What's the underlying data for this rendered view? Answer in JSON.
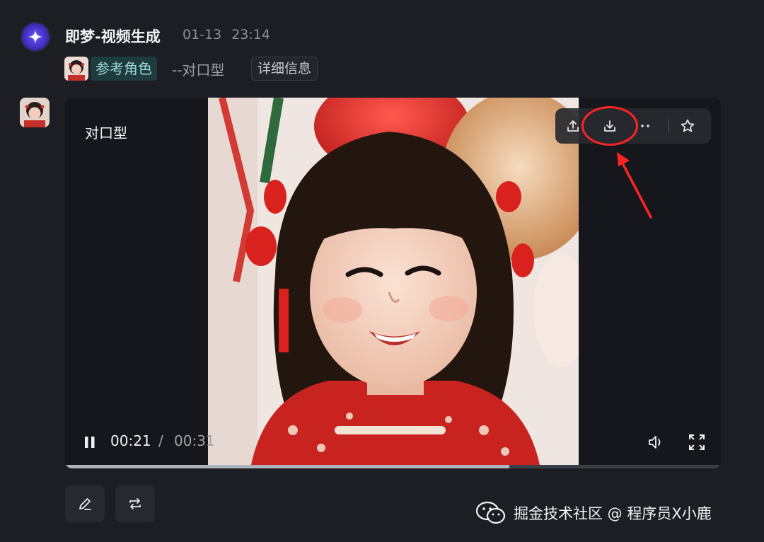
{
  "header": {
    "app_title": "即梦-视频生成",
    "date": "01-13",
    "time": "23:14"
  },
  "reference": {
    "chip_label": "参考角色",
    "mode": "--对口型",
    "detail_button": "详细信息"
  },
  "video": {
    "overlay_label": "对口型",
    "current_time": "00:21",
    "separator": "/",
    "total_time": "00:31",
    "progress": 0.677
  },
  "toolbar": {
    "icons": [
      "share-icon",
      "download-icon",
      "more-icon",
      "star-icon"
    ]
  },
  "actions": {
    "icons": [
      "edit-icon",
      "regenerate-icon"
    ]
  },
  "watermark": {
    "text": "掘金技术社区 @ 程序员X小鹿"
  },
  "colors": {
    "background": "#1c1e23",
    "accent_chip": "#1e3b3d",
    "annotation": "#ff2424"
  }
}
